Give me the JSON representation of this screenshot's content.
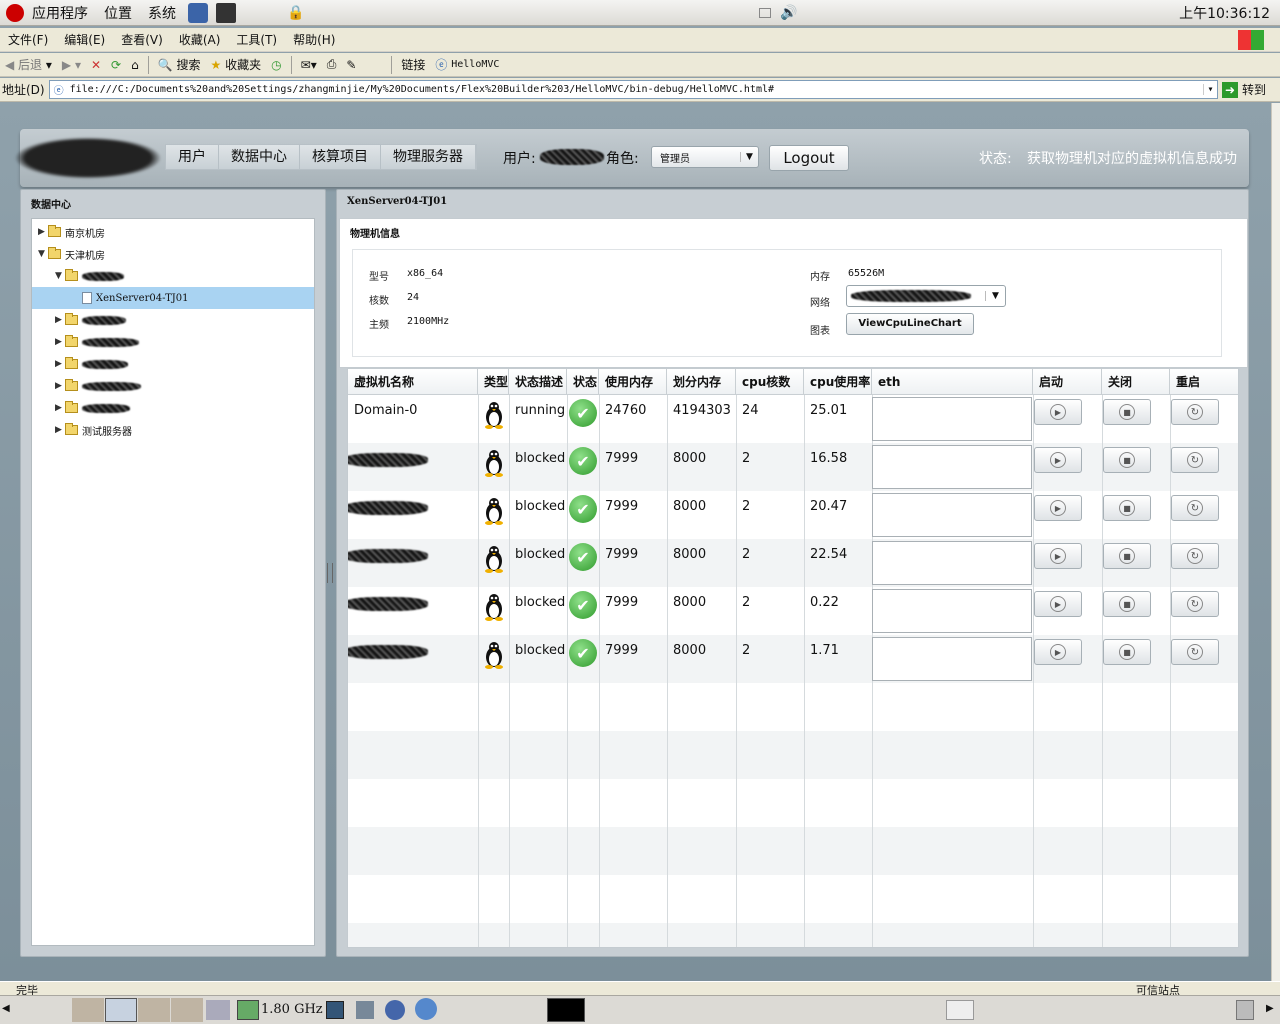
{
  "top_panel": {
    "apps": "应用程序",
    "places": "位置",
    "system": "系统",
    "clock": "上午10:36:12"
  },
  "menu": [
    "文件(F)",
    "编辑(E)",
    "查看(V)",
    "收藏(A)",
    "工具(T)",
    "帮助(H)"
  ],
  "toolbar": {
    "back": "后退",
    "search": "搜索",
    "favorites": "收藏夹",
    "links": "链接",
    "link_item": "HelloMVC"
  },
  "address": {
    "label": "地址(D)",
    "url": "file:///C:/Documents%20and%20Settings/zhangminjie/My%20Documents/Flex%20Builder%203/HelloMVC/bin-debug/HelloMVC.html#",
    "go": "转到"
  },
  "appbar": {
    "nav": [
      "用户",
      "数据中心",
      "核算项目",
      "物理服务器"
    ],
    "user_label": "用户:",
    "role_label": "角色:",
    "role_value": "管理员",
    "logout": "Logout",
    "status_label": "状态:",
    "status_text": "获取物理机对应的虚拟机信息成功"
  },
  "left_panel": {
    "title": "数据中心",
    "tree": [
      {
        "label": "南京机房",
        "level": 0,
        "state": "collapsed",
        "type": "folder"
      },
      {
        "label": "天津机房",
        "level": 0,
        "state": "expanded",
        "type": "folder"
      },
      {
        "label": "",
        "level": 1,
        "state": "expanded",
        "type": "folder"
      },
      {
        "label": "XenServer04-TJ01",
        "level": 2,
        "state": "selected",
        "type": "file"
      },
      {
        "label": "",
        "level": 1,
        "state": "collapsed",
        "type": "folder"
      },
      {
        "label": "",
        "level": 1,
        "state": "collapsed",
        "type": "folder"
      },
      {
        "label": "",
        "level": 1,
        "state": "collapsed",
        "type": "folder"
      },
      {
        "label": "",
        "level": 1,
        "state": "collapsed",
        "type": "folder"
      },
      {
        "label": "",
        "level": 1,
        "state": "collapsed",
        "type": "folder"
      },
      {
        "label": "测试服务器",
        "level": 1,
        "state": "collapsed",
        "type": "folder"
      }
    ]
  },
  "right_panel": {
    "title": "XenServer04-TJ01",
    "phys_title": "物理机信息",
    "model_label": "型号",
    "model": "x86_64",
    "cores_label": "核数",
    "cores": "24",
    "freq_label": "主频",
    "freq": "2100MHz",
    "mem_label": "内存",
    "mem": "65526M",
    "net_label": "网络",
    "chart_label": "图表",
    "chart_button": "ViewCpuLineChart"
  },
  "grid": {
    "headers": [
      "虚拟机名称",
      "类型",
      "状态描述",
      "状态",
      "使用内存",
      "划分内存",
      "cpu核数",
      "cpu使用率",
      "eth",
      "启动",
      "关闭",
      "重启"
    ],
    "rows": [
      {
        "name": "Domain-0",
        "state": "running",
        "used_mem": "24760",
        "alloc_mem": "4194303",
        "cpus": "24",
        "cpu_usage": "25.01"
      },
      {
        "name": "",
        "state": "blocked",
        "used_mem": "7999",
        "alloc_mem": "8000",
        "cpus": "2",
        "cpu_usage": "16.58"
      },
      {
        "name": "",
        "state": "blocked",
        "used_mem": "7999",
        "alloc_mem": "8000",
        "cpus": "2",
        "cpu_usage": "20.47"
      },
      {
        "name": "",
        "state": "blocked",
        "used_mem": "7999",
        "alloc_mem": "8000",
        "cpus": "2",
        "cpu_usage": "22.54"
      },
      {
        "name": "",
        "state": "blocked",
        "used_mem": "7999",
        "alloc_mem": "8000",
        "cpus": "2",
        "cpu_usage": "0.22"
      },
      {
        "name": "",
        "state": "blocked",
        "used_mem": "7999",
        "alloc_mem": "8000",
        "cpus": "2",
        "cpu_usage": "1.71"
      }
    ]
  },
  "statusbar": {
    "left": "完毕",
    "right": "可信站点"
  },
  "taskbar": {
    "cpu_freq": "1.80 GHz"
  }
}
